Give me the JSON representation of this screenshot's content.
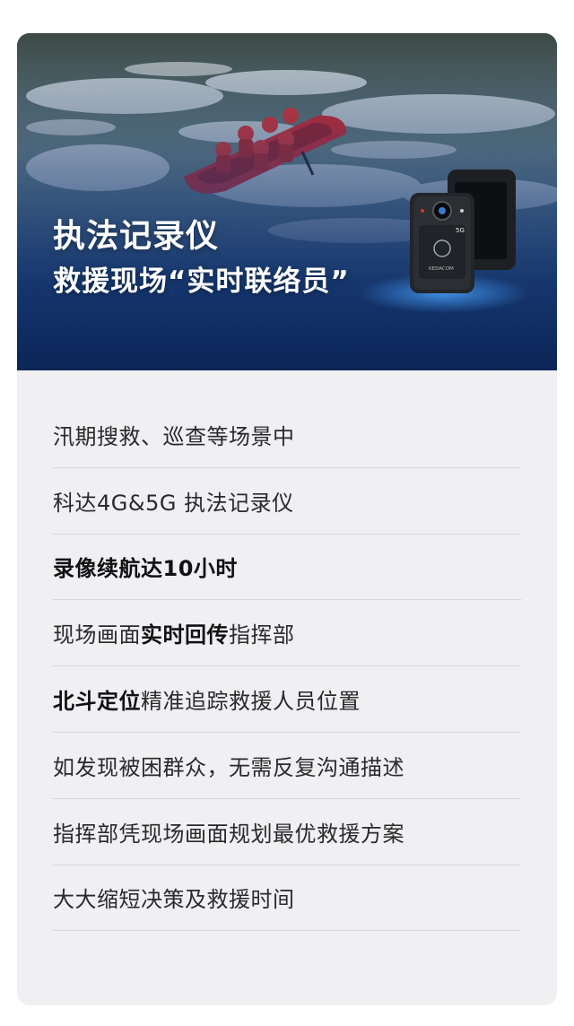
{
  "hero": {
    "title": "执法记录仪",
    "subtitle": "救援现场“实时联络员”",
    "device_badge": "5G",
    "device_brand": "KEDACOM"
  },
  "items": [
    {
      "parts": [
        {
          "text": "汛期搜救、巡查等场景中",
          "bold": false
        }
      ]
    },
    {
      "parts": [
        {
          "text": "科达4G&5G 执法记录仪",
          "bold": false
        }
      ]
    },
    {
      "parts": [
        {
          "text": "录像续航达10小时",
          "bold": true
        }
      ]
    },
    {
      "parts": [
        {
          "text": "现场画面",
          "bold": false
        },
        {
          "text": "实时回传",
          "bold": true
        },
        {
          "text": "指挥部",
          "bold": false
        }
      ]
    },
    {
      "parts": [
        {
          "text": "北斗定位",
          "bold": true
        },
        {
          "text": "精准追踪救援人员位置",
          "bold": false
        }
      ]
    },
    {
      "parts": [
        {
          "text": "如发现被困群众，无需反复沟通描述",
          "bold": false
        }
      ]
    },
    {
      "parts": [
        {
          "text": "指挥部凭现场画面规划最优救援方案",
          "bold": false
        }
      ]
    },
    {
      "parts": [
        {
          "text": "大大缩短决策及救援时间",
          "bold": false
        }
      ]
    }
  ]
}
